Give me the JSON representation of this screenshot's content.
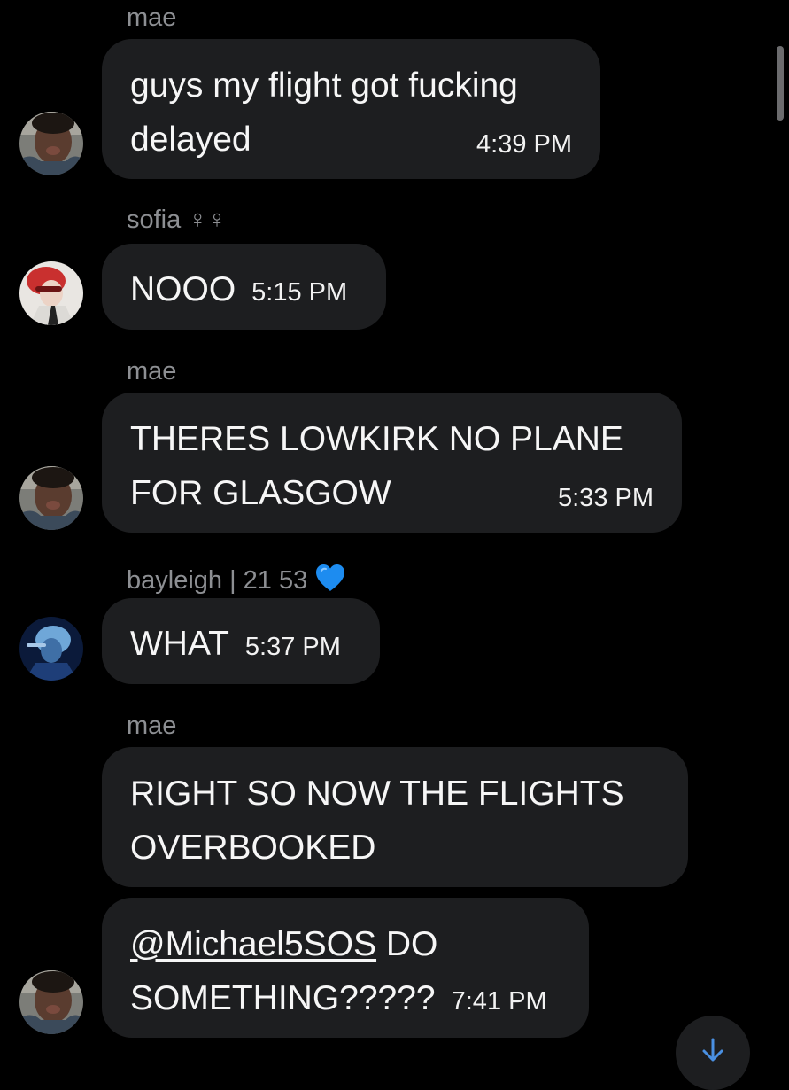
{
  "messages": [
    {
      "sender": "mae",
      "text_lines": [
        "guys my flight got fucking",
        "delayed"
      ],
      "time": "4:39 PM"
    },
    {
      "sender": "sofia ♀︎♀︎",
      "text": "NOOO",
      "time": "5:15 PM"
    },
    {
      "sender": "mae",
      "text_lines": [
        "THERES LOWKIRK NO PLANE",
        "FOR GLASGOW"
      ],
      "time": "5:33 PM"
    },
    {
      "sender": "bayleigh | 21 53",
      "sender_emoji": "blue-heart",
      "text": "WHAT",
      "time": "5:37 PM"
    },
    {
      "sender": "mae",
      "text_lines": [
        "RIGHT SO NOW THE FLIGHTS",
        "OVERBOOKED"
      ]
    },
    {
      "mention": "@Michael5SOS",
      "text_after_mention": " DO",
      "text_line2": "SOMETHING?????",
      "time": "7:41 PM"
    }
  ],
  "icons": {
    "scroll_down": "arrow-down-icon",
    "sender_emoji": "blue-heart-icon"
  },
  "colors": {
    "background": "#000000",
    "bubble": "#1d1e20",
    "sender_name": "#8d8f93",
    "message_text": "#f6f6f6",
    "accent_arrow": "#4a90e2",
    "heart": "#1d8cf0"
  }
}
